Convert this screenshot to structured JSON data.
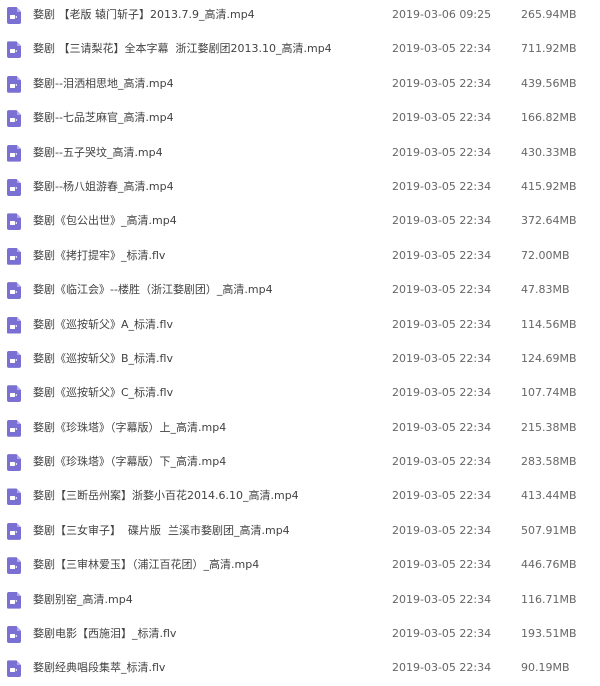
{
  "file_list": {
    "icon": "video-file-icon",
    "icon_color": "#7a6fd3",
    "rows": [
      {
        "name": "婺剧 【老版 辕门斩子】2013.7.9_高清.mp4",
        "modified": "2019-03-06 09:25",
        "size": "265.94MB"
      },
      {
        "name": "婺剧 【三请梨花】全本字幕  浙江婺剧团2013.10_高清.mp4",
        "modified": "2019-03-05 22:34",
        "size": "711.92MB"
      },
      {
        "name": "婺剧--泪洒相思地_高清.mp4",
        "modified": "2019-03-05 22:34",
        "size": "439.56MB"
      },
      {
        "name": "婺剧--七品芝麻官_高清.mp4",
        "modified": "2019-03-05 22:34",
        "size": "166.82MB"
      },
      {
        "name": "婺剧--五子哭坟_高清.mp4",
        "modified": "2019-03-05 22:34",
        "size": "430.33MB"
      },
      {
        "name": "婺剧--杨八姐游春_高清.mp4",
        "modified": "2019-03-05 22:34",
        "size": "415.92MB"
      },
      {
        "name": "婺剧《包公出世》_高清.mp4",
        "modified": "2019-03-05 22:34",
        "size": "372.64MB"
      },
      {
        "name": "婺剧《拷打提牢》_标清.flv",
        "modified": "2019-03-05 22:34",
        "size": "72.00MB"
      },
      {
        "name": "婺剧《临江会》--楼胜（浙江婺剧团）_高清.mp4",
        "modified": "2019-03-05 22:34",
        "size": "47.83MB"
      },
      {
        "name": "婺剧《巡按斩父》A_标清.flv",
        "modified": "2019-03-05 22:34",
        "size": "114.56MB"
      },
      {
        "name": "婺剧《巡按斩父》B_标清.flv",
        "modified": "2019-03-05 22:34",
        "size": "124.69MB"
      },
      {
        "name": "婺剧《巡按斩父》C_标清.flv",
        "modified": "2019-03-05 22:34",
        "size": "107.74MB"
      },
      {
        "name": "婺剧《珍珠塔》（字幕版）上_高清.mp4",
        "modified": "2019-03-05 22:34",
        "size": "215.38MB"
      },
      {
        "name": "婺剧《珍珠塔》（字幕版）下_高清.mp4",
        "modified": "2019-03-05 22:34",
        "size": "283.58MB"
      },
      {
        "name": "婺剧【三断岳州案】浙婺小百花2014.6.10_高清.mp4",
        "modified": "2019-03-05 22:34",
        "size": "413.44MB"
      },
      {
        "name": "婺剧【三女审子】  碟片版  兰溪市婺剧团_高清.mp4",
        "modified": "2019-03-05 22:34",
        "size": "507.91MB"
      },
      {
        "name": "婺剧【三审林爱玉】（浦江百花团）_高清.mp4",
        "modified": "2019-03-05 22:34",
        "size": "446.76MB"
      },
      {
        "name": "婺剧别窑_高清.mp4",
        "modified": "2019-03-05 22:34",
        "size": "116.71MB"
      },
      {
        "name": "婺剧电影【西施泪】_标清.flv",
        "modified": "2019-03-05 22:34",
        "size": "193.51MB"
      },
      {
        "name": "婺剧经典唱段集萃_标清.flv",
        "modified": "2019-03-05 22:34",
        "size": "90.19MB"
      }
    ]
  }
}
